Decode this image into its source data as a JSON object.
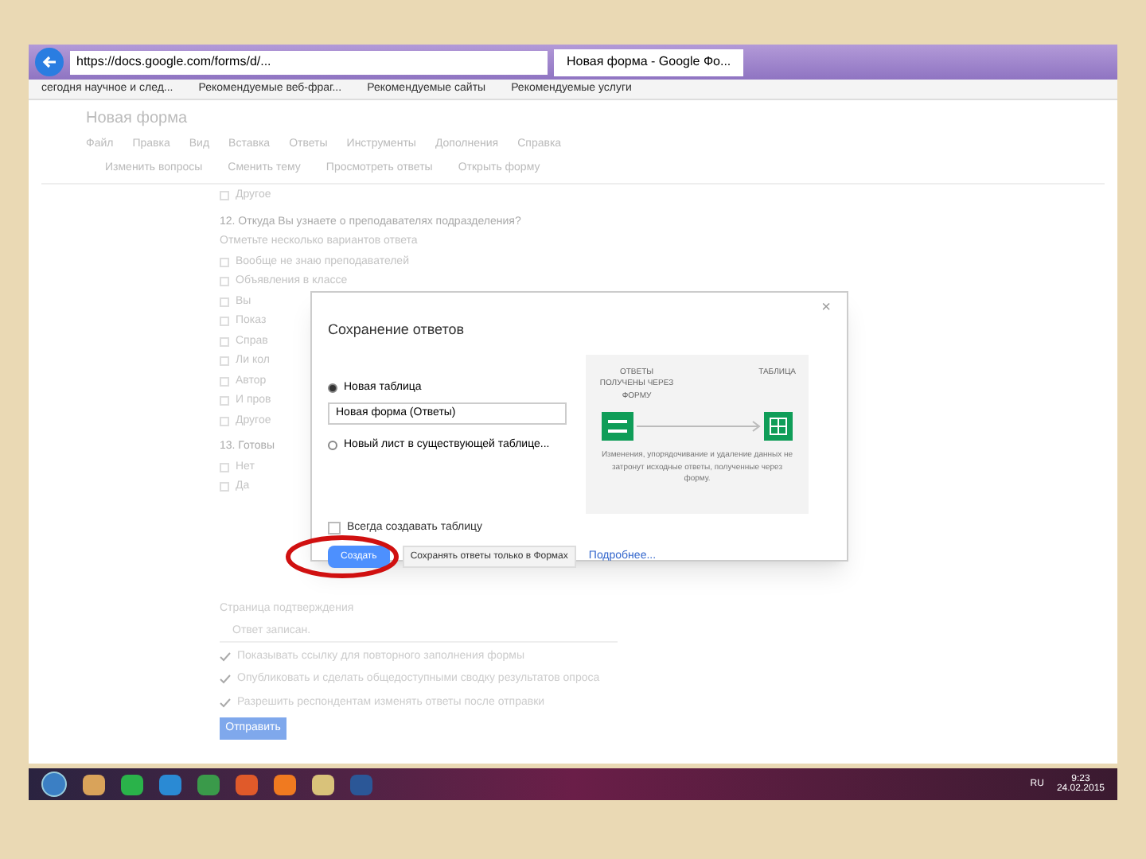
{
  "browser": {
    "url": "https://docs.google.com/forms/d/...",
    "tab": {
      "title": "Новая форма - Google Фо...",
      "selected": true
    },
    "favorites": [
      "сегодня научное и след...",
      "Рекомендуемые веб-фраг...",
      "Рекомендуемые сайты",
      "Рекомендуемые услуги"
    ]
  },
  "app": {
    "title": "Новая форма",
    "menu": [
      "Файл",
      "Правка",
      "Вид",
      "Вставка",
      "Ответы",
      "Инструменты",
      "Дополнения",
      "Справка"
    ],
    "toolbar": [
      "Изменить вопросы",
      "Сменить тему",
      "Просмотреть ответы",
      "Открыть форму"
    ]
  },
  "form": {
    "items": [
      {
        "kind": "option",
        "text": "Другое",
        "checked": false
      },
      {
        "kind": "question",
        "text": "12. Откуда Вы узнаете о преподавателях подразделения?"
      },
      {
        "kind": "hint",
        "text": "Отметьте несколько вариантов ответа"
      },
      {
        "kind": "option",
        "text": "Вообще не знаю преподавателей",
        "checked": false
      },
      {
        "kind": "option",
        "text": "Объявления в классе",
        "checked": false
      },
      {
        "kind": "option",
        "text": "Вы",
        "checked": false
      },
      {
        "kind": "option",
        "text": "Показ",
        "checked": false
      },
      {
        "kind": "option",
        "text": "Справ",
        "checked": false
      },
      {
        "kind": "option",
        "text": "Ли кол",
        "checked": false
      },
      {
        "kind": "option",
        "text": "Автор",
        "checked": false
      },
      {
        "kind": "option",
        "text": "И пров",
        "checked": false
      },
      {
        "kind": "option",
        "text": "Другое",
        "checked": false
      },
      {
        "kind": "question",
        "text": "13. Готовы"
      },
      {
        "kind": "option",
        "text": "Нет",
        "checked": false
      },
      {
        "kind": "option",
        "text": "Да",
        "checked": false
      }
    ],
    "confirmation": {
      "heading": "Страница подтверждения",
      "field": "Ответ записан.",
      "options": [
        {
          "text": "Показывать ссылку для повторного заполнения формы",
          "checked": true
        },
        {
          "text": "Опубликовать и сделать общедоступными сводку результатов опроса",
          "checked": true
        },
        {
          "text": "Разрешить респондентам изменять ответы после отправки",
          "checked": true
        }
      ],
      "button": "Отправить"
    }
  },
  "dialog": {
    "title": "Сохранение ответов",
    "close": "×",
    "choices": [
      {
        "label": "Новая таблица",
        "selected": true
      },
      {
        "label": "Новый лист в существующей таблице...",
        "selected": false
      }
    ],
    "name_value": "Новая форма (Ответы)",
    "diagram": {
      "left": "ОТВЕТЫ ПОЛУЧЕНЫ ЧЕРЕЗ ФОРМУ",
      "right": "ТАБЛИЦА",
      "caption": "Изменения, упорядочивание и удаление данных не затронут исходные ответы, полученные через форму."
    },
    "always": {
      "label": "Всегда создавать таблицу",
      "checked": false
    },
    "buttons": [
      "Создать",
      "Сохранять ответы только в Формах"
    ],
    "link": "Подробнее..."
  },
  "taskbar": {
    "lang": "RU",
    "time": "9:23",
    "date": "24.02.2015"
  }
}
